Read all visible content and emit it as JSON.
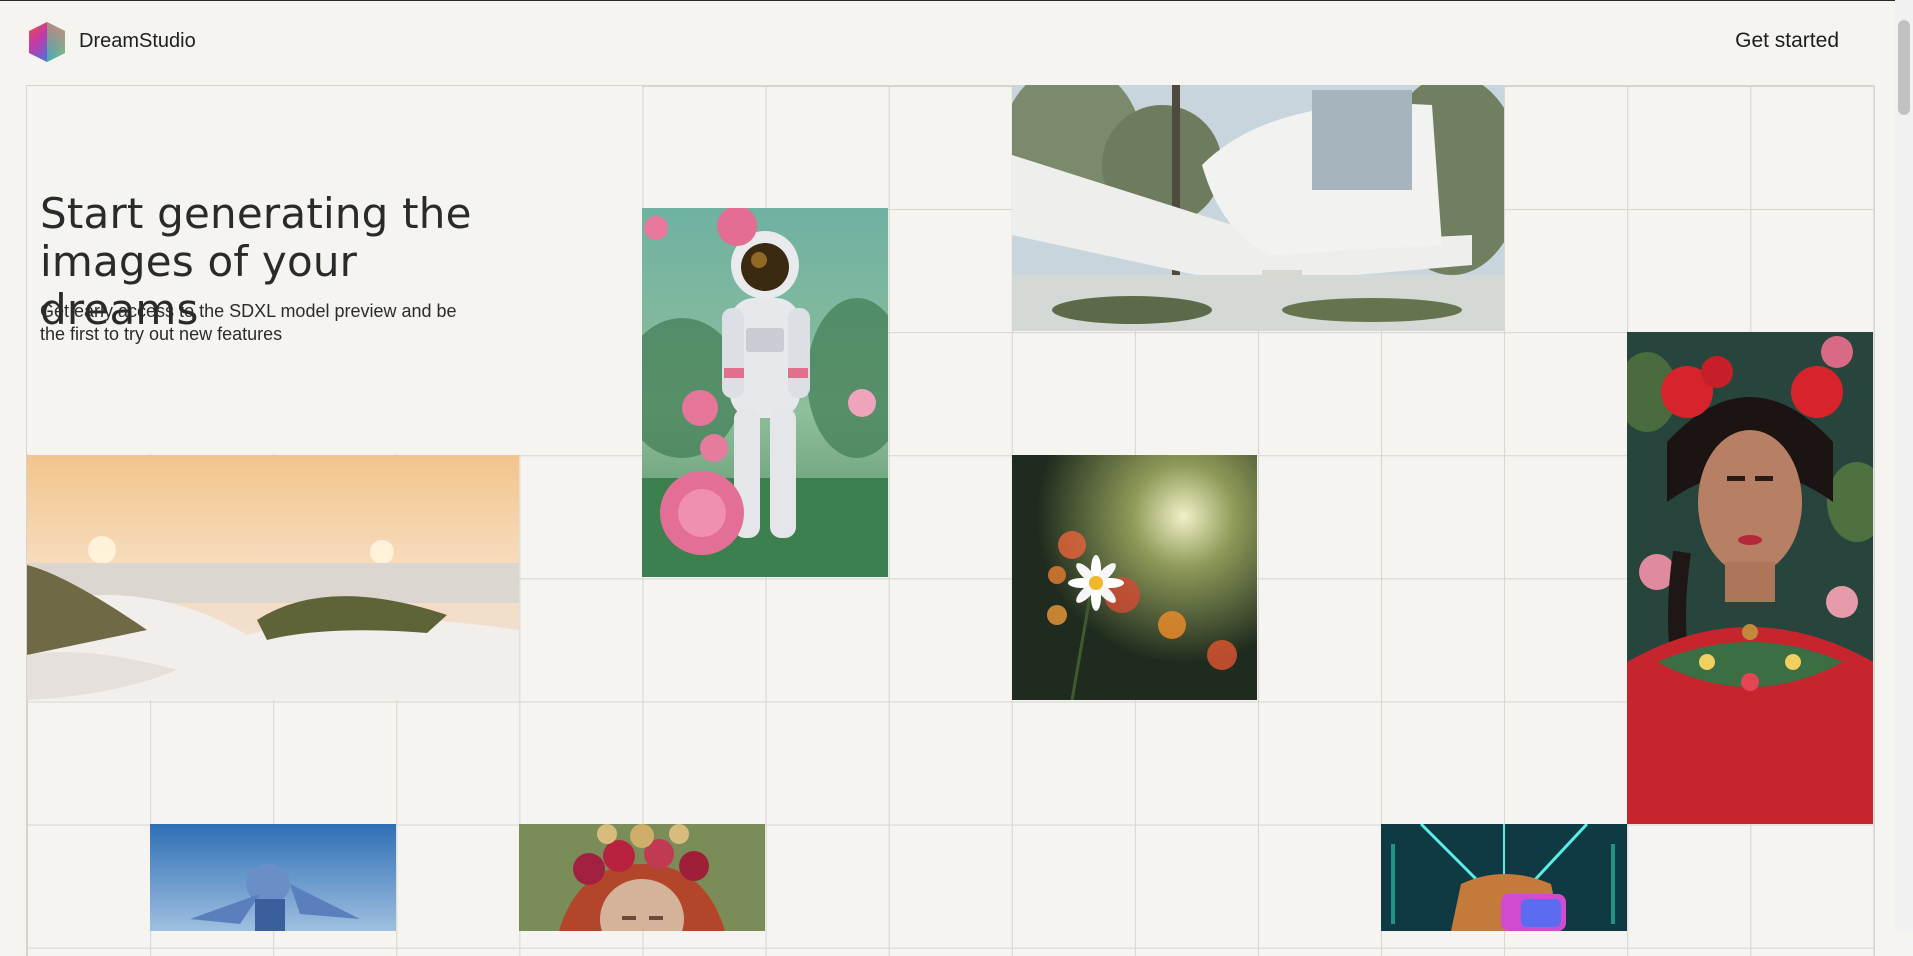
{
  "app": {
    "brand": "DreamStudio",
    "cta_label": "Get started"
  },
  "hero": {
    "title": "Start generating the images of your dreams",
    "subtitle": "Get early access to the SDXL model preview and be the first to try out new features"
  },
  "gallery": {
    "images": [
      {
        "name": "astronaut-roses-image"
      },
      {
        "name": "modern-house-image"
      },
      {
        "name": "beach-dunes-image"
      },
      {
        "name": "daisy-flowers-image"
      },
      {
        "name": "frida-portrait-image"
      },
      {
        "name": "blue-robot-image"
      },
      {
        "name": "flower-crown-portrait-image"
      },
      {
        "name": "neon-dog-image"
      }
    ]
  },
  "colors": {
    "background": "#f5f4f1",
    "grid_line": "#d6d4cf",
    "text": "#222222"
  }
}
